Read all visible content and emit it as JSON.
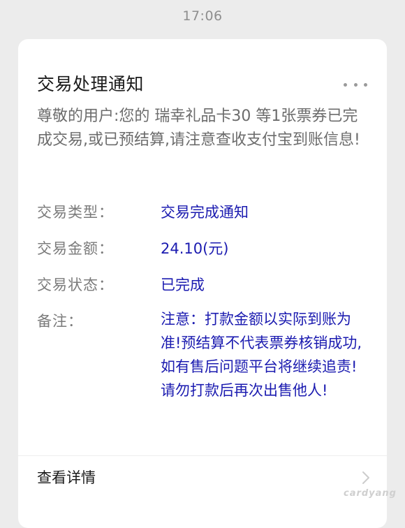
{
  "status_bar": {
    "time": "17:06"
  },
  "card": {
    "title": "交易处理通知",
    "more_icon": "more-horizontal-icon",
    "description": "尊敬的用户:您的 瑞幸礼品卡30 等1张票券已完成交易,或已预结算,请注意查收支付宝到账信息!",
    "rows": [
      {
        "label": "交易类型：",
        "value": "交易完成通知"
      },
      {
        "label": "交易金额：",
        "value": "24.10(元)"
      },
      {
        "label": "交易状态：",
        "value": "已完成"
      },
      {
        "label": "备注：",
        "value": "注意：打款金额以实际到账为准!预结算不代表票券核销成功,如有售后问题平台将继续追责!请勿打款后再次出售他人!"
      }
    ],
    "footer": {
      "details_label": "查看详情",
      "chevron_icon": "chevron-right-icon"
    }
  },
  "watermark": {
    "text": "cardyang"
  },
  "colors": {
    "background": "#ececec",
    "card": "#ffffff",
    "value_text": "#1b1bb0",
    "label_text": "#7b7b7b"
  }
}
